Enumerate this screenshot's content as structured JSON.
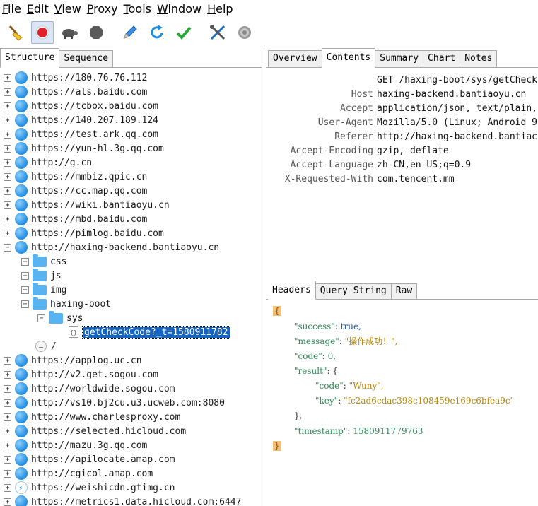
{
  "menu": [
    "File",
    "Edit",
    "View",
    "Proxy",
    "Tools",
    "Window",
    "Help"
  ],
  "menu_underline": [
    "F",
    "E",
    "V",
    "P",
    "T",
    "W",
    "H"
  ],
  "menu_rest": [
    "ile",
    "dit",
    "iew",
    "roxy",
    "ools",
    "indow",
    "elp"
  ],
  "toolbar": {
    "icons": [
      "broom-icon",
      "record-icon",
      "turtle-icon",
      "stop-icon",
      "pen-icon",
      "refresh-icon",
      "check-icon",
      "tools-icon",
      "settings-icon"
    ]
  },
  "left_tabs": [
    "Structure",
    "Sequence"
  ],
  "tree": {
    "hosts_top": [
      "https://180.76.76.112",
      "https://als.baidu.com",
      "https://tcbox.baidu.com",
      "https://140.207.189.124",
      "https://test.ark.qq.com",
      "https://yun-hl.3g.qq.com",
      "http://g.cn",
      "https://mmbiz.qpic.cn",
      "https://cc.map.qq.com",
      "https://wiki.bantiaoyu.cn",
      "https://mbd.baidu.com",
      "https://pimlog.baidu.com"
    ],
    "expanded_host": "http://haxing-backend.bantiaoyu.cn",
    "folders": [
      "css",
      "js",
      "img"
    ],
    "boot_folder": "haxing-boot",
    "sys_folder": "sys",
    "selected_file": "getCheckCode?_t=1580911782",
    "root_item": "/",
    "hosts_bottom": [
      "https://applog.uc.cn",
      "http://v2.get.sogou.com",
      "http://worldwide.sogou.com",
      "http://vs10.bj2cu.u3.ucweb.com:8080",
      "http://www.charlesproxy.com",
      "https://selected.hicloud.com",
      "http://mazu.3g.qq.com",
      "https://apilocate.amap.com",
      "http://cgicol.amap.com",
      "https://weishicdn.gtimg.cn",
      "https://metrics1.data.hicloud.com:6447"
    ]
  },
  "right_tabs": [
    "Overview",
    "Contents",
    "Summary",
    "Chart",
    "Notes"
  ],
  "request_headers": [
    {
      "key": "",
      "value": "GET /haxing-boot/sys/getCheck"
    },
    {
      "key": "Host",
      "value": "haxing-backend.bantiaoyu.cn"
    },
    {
      "key": "Accept",
      "value": "application/json, text/plain,"
    },
    {
      "key": "User-Agent",
      "value": "Mozilla/5.0 (Linux; Android 9"
    },
    {
      "key": "Referer",
      "value": "http://haxing-backend.bantiac"
    },
    {
      "key": "Accept-Encoding",
      "value": "gzip, deflate"
    },
    {
      "key": "Accept-Language",
      "value": "zh-CN,en-US;q=0.9"
    },
    {
      "key": "X-Requested-With",
      "value": "com.tencent.mm"
    }
  ],
  "response_tabs": [
    "Headers",
    "Query String",
    "Raw"
  ],
  "json": {
    "open": "{",
    "close": "}",
    "success_key": "\"success\"",
    "success_val": "true,",
    "message_key": "\"message\"",
    "message_val": "\"操作成功！\",",
    "code_key": "\"code\"",
    "code_val": "0,",
    "result_key": "\"result\"",
    "result_open": "{",
    "rcode_key": "\"code\"",
    "rcode_val": "\"Wuny\",",
    "rkey_key": "\"key\"",
    "rkey_val": "\"fc2ad6cdac398c108459e169c6bfea9c\"",
    "result_close": "},",
    "timestamp_key": "\"timestamp\"",
    "timestamp_val": "1580911779763",
    "colon": ": "
  },
  "colors": {
    "selection": "#1565c0",
    "json_key": "#2e8b57",
    "json_string": "#b8860b",
    "brace_highlight": "#f3c17a"
  }
}
